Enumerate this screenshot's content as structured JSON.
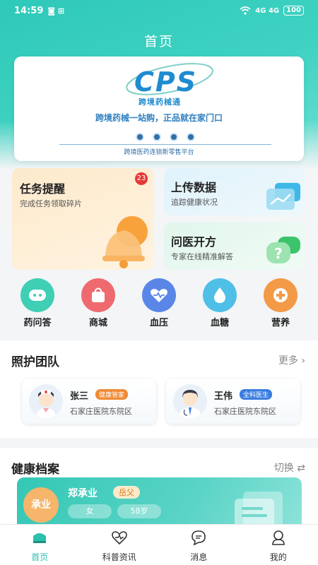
{
  "status_bar": {
    "time": "14:59",
    "notif_icons": "◙ ⊞",
    "network": "4G 4G",
    "battery": "100"
  },
  "header": {
    "title": "首页"
  },
  "banner": {
    "logo_text": "CPS",
    "logo_sub": "跨境药械通",
    "slogan": "跨境药械一站购，正品就在家门口",
    "platform": "跨境医药连锁新零售平台"
  },
  "cards": {
    "task": {
      "title": "任务提醒",
      "subtitle": "完成任务领取碎片",
      "badge": "23"
    },
    "upload": {
      "title": "上传数据",
      "subtitle": "追踪健康状况"
    },
    "doctor": {
      "title": "问医开方",
      "subtitle": "专家在线精准解答"
    }
  },
  "quick_links": [
    {
      "label": "药问答",
      "icon": "robot-icon",
      "color": "#3fcfb5"
    },
    {
      "label": "商城",
      "icon": "shopping-bag-icon",
      "color": "#ef6a6f"
    },
    {
      "label": "血压",
      "icon": "heart-pulse-icon",
      "color": "#5a86e8"
    },
    {
      "label": "血糖",
      "icon": "blood-drop-icon",
      "color": "#4fbfe8"
    },
    {
      "label": "营养",
      "icon": "nutrition-plus-icon",
      "color": "#f39a47"
    }
  ],
  "care_team": {
    "title": "照护团队",
    "more": "更多",
    "members": [
      {
        "name": "张三",
        "tag": "健康管家",
        "hospital": "石家庄医院东院区"
      },
      {
        "name": "王伟",
        "tag": "全科医生",
        "hospital": "石家庄医院东院区"
      }
    ]
  },
  "health_record": {
    "title": "健康档案",
    "switch": "切换",
    "avatar_text": "承业",
    "name": "郑承业",
    "relation": "岳父",
    "gender": "女",
    "age": "58岁"
  },
  "bottom_nav": [
    {
      "label": "首页",
      "icon": "home-icon",
      "active": true
    },
    {
      "label": "科普资讯",
      "icon": "heart-outline-icon",
      "active": false
    },
    {
      "label": "消息",
      "icon": "message-icon",
      "active": false
    },
    {
      "label": "我的",
      "icon": "profile-icon",
      "active": false
    }
  ]
}
